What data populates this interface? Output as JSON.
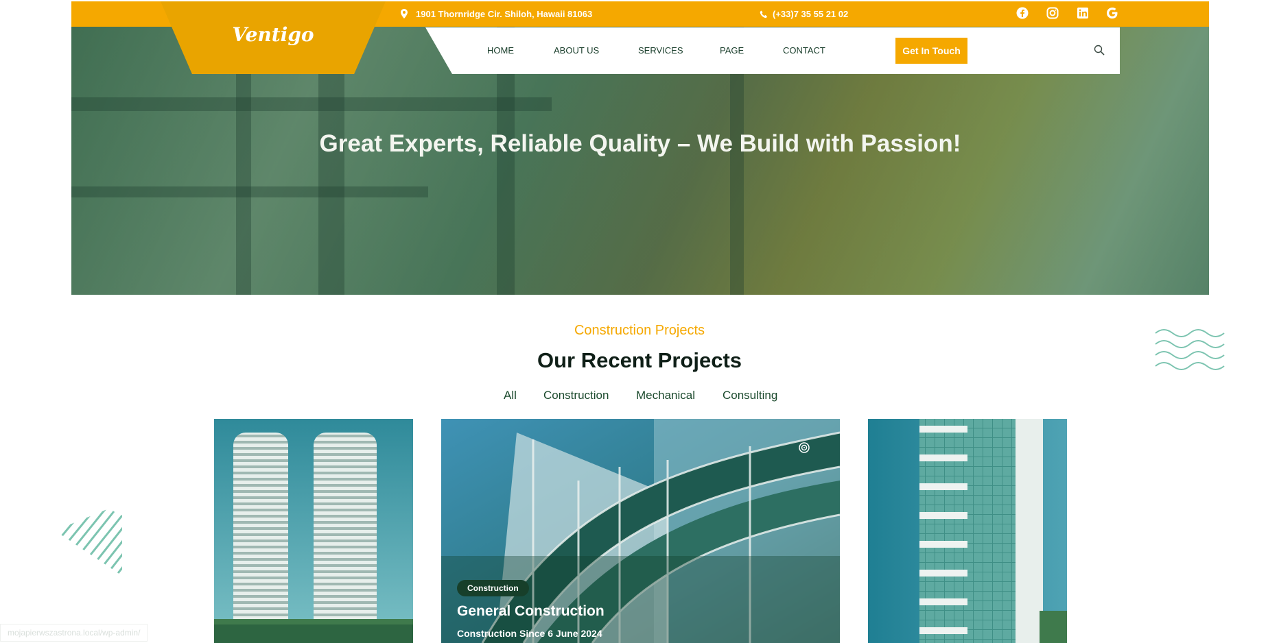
{
  "brand": {
    "logo_text": "Ventigo",
    "accent_color": "#f5a800",
    "dark_green": "#173f2a"
  },
  "topbar": {
    "address": "1901 Thornridge Cir. Shiloh, Hawaii 81063",
    "phone": "(+33)7 35 55 21 02",
    "social": [
      "facebook-icon",
      "instagram-icon",
      "linkedin-icon",
      "google-icon"
    ]
  },
  "nav": {
    "items": [
      "HOME",
      "ABOUT US",
      "SERVICES",
      "PAGE",
      "CONTACT"
    ],
    "cta": "Get In Touch"
  },
  "hero": {
    "title": "Great Experts, Reliable Quality – We Build with Passion!"
  },
  "projects": {
    "eyebrow": "Construction Projects",
    "title": "Our Recent Projects",
    "filters": [
      "All",
      "Construction",
      "Mechanical",
      "Consulting"
    ],
    "featured": {
      "badge": "Construction",
      "title": "General Construction",
      "subtitle": "Construction Since 6 June 2024"
    }
  },
  "status_url": "mojapierwszastrona.local/wp-admin/"
}
